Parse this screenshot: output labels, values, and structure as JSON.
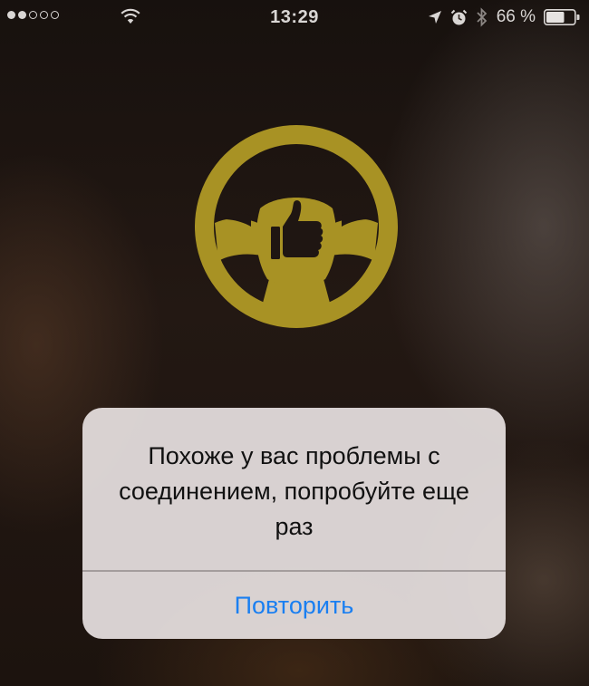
{
  "status_bar": {
    "time": "13:29",
    "battery_percent": "66 %",
    "battery_level": 0.66,
    "signal_strength": {
      "filled": 2,
      "total": 5
    },
    "icons": [
      "wifi-icon",
      "location-arrow-icon",
      "alarm-icon",
      "bluetooth-icon",
      "battery-icon"
    ]
  },
  "logo": {
    "icon": "steering-wheel-thumbs-up-icon",
    "color": "#a89224"
  },
  "alert": {
    "message": "Похоже у вас проблемы с соединением, попробуйте еще раз",
    "button_label": "Повторить",
    "button_color": "#1a7ff1"
  }
}
